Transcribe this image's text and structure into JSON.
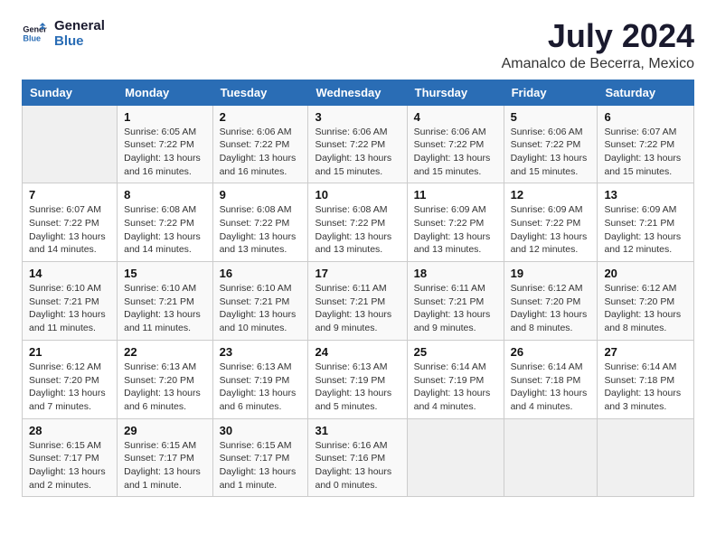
{
  "logo": {
    "line1": "General",
    "line2": "Blue"
  },
  "title": "July 2024",
  "subtitle": "Amanalco de Becerra, Mexico",
  "weekdays": [
    "Sunday",
    "Monday",
    "Tuesday",
    "Wednesday",
    "Thursday",
    "Friday",
    "Saturday"
  ],
  "weeks": [
    [
      {
        "day": "",
        "info": ""
      },
      {
        "day": "1",
        "info": "Sunrise: 6:05 AM\nSunset: 7:22 PM\nDaylight: 13 hours\nand 16 minutes."
      },
      {
        "day": "2",
        "info": "Sunrise: 6:06 AM\nSunset: 7:22 PM\nDaylight: 13 hours\nand 16 minutes."
      },
      {
        "day": "3",
        "info": "Sunrise: 6:06 AM\nSunset: 7:22 PM\nDaylight: 13 hours\nand 15 minutes."
      },
      {
        "day": "4",
        "info": "Sunrise: 6:06 AM\nSunset: 7:22 PM\nDaylight: 13 hours\nand 15 minutes."
      },
      {
        "day": "5",
        "info": "Sunrise: 6:06 AM\nSunset: 7:22 PM\nDaylight: 13 hours\nand 15 minutes."
      },
      {
        "day": "6",
        "info": "Sunrise: 6:07 AM\nSunset: 7:22 PM\nDaylight: 13 hours\nand 15 minutes."
      }
    ],
    [
      {
        "day": "7",
        "info": "Sunrise: 6:07 AM\nSunset: 7:22 PM\nDaylight: 13 hours\nand 14 minutes."
      },
      {
        "day": "8",
        "info": "Sunrise: 6:08 AM\nSunset: 7:22 PM\nDaylight: 13 hours\nand 14 minutes."
      },
      {
        "day": "9",
        "info": "Sunrise: 6:08 AM\nSunset: 7:22 PM\nDaylight: 13 hours\nand 13 minutes."
      },
      {
        "day": "10",
        "info": "Sunrise: 6:08 AM\nSunset: 7:22 PM\nDaylight: 13 hours\nand 13 minutes."
      },
      {
        "day": "11",
        "info": "Sunrise: 6:09 AM\nSunset: 7:22 PM\nDaylight: 13 hours\nand 13 minutes."
      },
      {
        "day": "12",
        "info": "Sunrise: 6:09 AM\nSunset: 7:22 PM\nDaylight: 13 hours\nand 12 minutes."
      },
      {
        "day": "13",
        "info": "Sunrise: 6:09 AM\nSunset: 7:21 PM\nDaylight: 13 hours\nand 12 minutes."
      }
    ],
    [
      {
        "day": "14",
        "info": "Sunrise: 6:10 AM\nSunset: 7:21 PM\nDaylight: 13 hours\nand 11 minutes."
      },
      {
        "day": "15",
        "info": "Sunrise: 6:10 AM\nSunset: 7:21 PM\nDaylight: 13 hours\nand 11 minutes."
      },
      {
        "day": "16",
        "info": "Sunrise: 6:10 AM\nSunset: 7:21 PM\nDaylight: 13 hours\nand 10 minutes."
      },
      {
        "day": "17",
        "info": "Sunrise: 6:11 AM\nSunset: 7:21 PM\nDaylight: 13 hours\nand 9 minutes."
      },
      {
        "day": "18",
        "info": "Sunrise: 6:11 AM\nSunset: 7:21 PM\nDaylight: 13 hours\nand 9 minutes."
      },
      {
        "day": "19",
        "info": "Sunrise: 6:12 AM\nSunset: 7:20 PM\nDaylight: 13 hours\nand 8 minutes."
      },
      {
        "day": "20",
        "info": "Sunrise: 6:12 AM\nSunset: 7:20 PM\nDaylight: 13 hours\nand 8 minutes."
      }
    ],
    [
      {
        "day": "21",
        "info": "Sunrise: 6:12 AM\nSunset: 7:20 PM\nDaylight: 13 hours\nand 7 minutes."
      },
      {
        "day": "22",
        "info": "Sunrise: 6:13 AM\nSunset: 7:20 PM\nDaylight: 13 hours\nand 6 minutes."
      },
      {
        "day": "23",
        "info": "Sunrise: 6:13 AM\nSunset: 7:19 PM\nDaylight: 13 hours\nand 6 minutes."
      },
      {
        "day": "24",
        "info": "Sunrise: 6:13 AM\nSunset: 7:19 PM\nDaylight: 13 hours\nand 5 minutes."
      },
      {
        "day": "25",
        "info": "Sunrise: 6:14 AM\nSunset: 7:19 PM\nDaylight: 13 hours\nand 4 minutes."
      },
      {
        "day": "26",
        "info": "Sunrise: 6:14 AM\nSunset: 7:18 PM\nDaylight: 13 hours\nand 4 minutes."
      },
      {
        "day": "27",
        "info": "Sunrise: 6:14 AM\nSunset: 7:18 PM\nDaylight: 13 hours\nand 3 minutes."
      }
    ],
    [
      {
        "day": "28",
        "info": "Sunrise: 6:15 AM\nSunset: 7:17 PM\nDaylight: 13 hours\nand 2 minutes."
      },
      {
        "day": "29",
        "info": "Sunrise: 6:15 AM\nSunset: 7:17 PM\nDaylight: 13 hours\nand 1 minute."
      },
      {
        "day": "30",
        "info": "Sunrise: 6:15 AM\nSunset: 7:17 PM\nDaylight: 13 hours\nand 1 minute."
      },
      {
        "day": "31",
        "info": "Sunrise: 6:16 AM\nSunset: 7:16 PM\nDaylight: 13 hours\nand 0 minutes."
      },
      {
        "day": "",
        "info": ""
      },
      {
        "day": "",
        "info": ""
      },
      {
        "day": "",
        "info": ""
      }
    ]
  ]
}
